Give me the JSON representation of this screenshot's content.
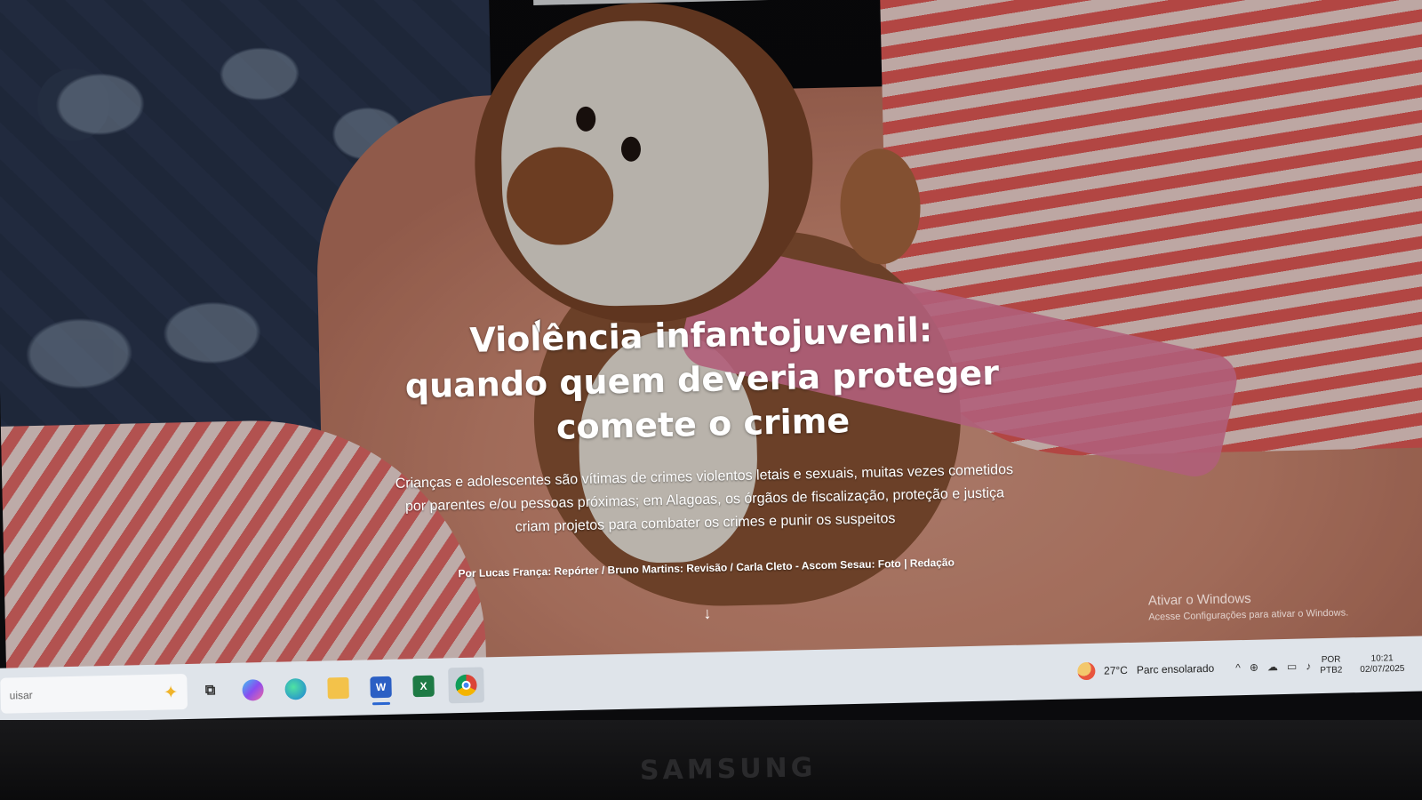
{
  "article": {
    "title": "Violência infantojuvenil: quando quem deveria proteger comete o crime",
    "subtitle": "Crianças e adolescentes são vítimas de crimes violentos letais e sexuais, muitas vezes cometidos por parentes e/ou pessoas próximas; em Alagoas, os órgãos de fiscalização, proteção e justiça criam projetos para combater os crimes e punir os suspeitos",
    "credits": "Por Lucas França: Repórter / Bruno Martins: Revisão / Carla Cleto - Ascom Sesau: Foto | Redação",
    "scroll_icon": "arrow-down-icon"
  },
  "watermark": {
    "line1": "Ativar o Windows",
    "line2": "Acesse Configurações para ativar o Windows."
  },
  "taskbar": {
    "search_placeholder": "uisar",
    "apps": [
      {
        "name": "task-view",
        "glyph": "⧉"
      },
      {
        "name": "copilot",
        "glyph": "◆"
      },
      {
        "name": "edge",
        "glyph": "e"
      },
      {
        "name": "file-explorer",
        "glyph": "▬"
      },
      {
        "name": "word",
        "glyph": "W"
      },
      {
        "name": "excel",
        "glyph": "X"
      },
      {
        "name": "chrome",
        "glyph": "●"
      }
    ],
    "tray": {
      "temperature": "27°C",
      "weather": "Parc ensolarado",
      "language_top": "POR",
      "language_bottom": "PTB2",
      "time": "10:21",
      "date": "02/07/2025"
    }
  },
  "monitor": {
    "brand": "SAMSUNG"
  },
  "colors": {
    "accent": "#2a66d1",
    "text": "#ffffff"
  }
}
